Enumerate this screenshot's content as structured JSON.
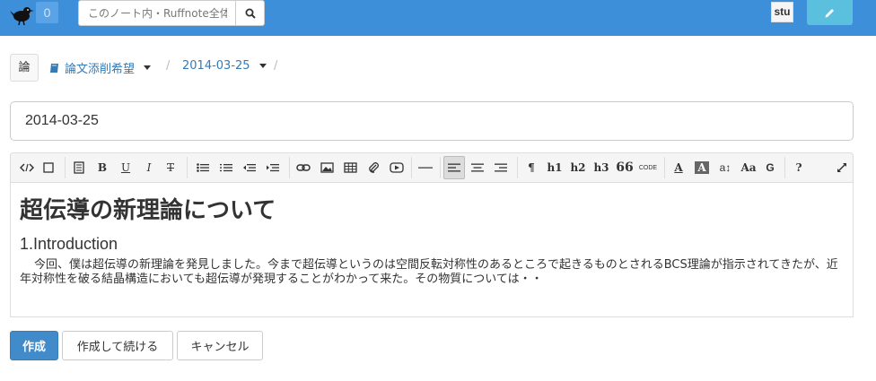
{
  "navbar": {
    "notification_count": "0",
    "search_placeholder": "このノート内・Ruffnote全体",
    "user_label": "stu"
  },
  "breadcrumb": {
    "note_icon_label": "論",
    "notebook_label": "論文添削希望",
    "page_label": "2014-03-25",
    "separator": "/"
  },
  "title_field": {
    "value": "2014-03-25"
  },
  "toolbar": {
    "bold_label": "B",
    "underline_label": "U",
    "italic_label": "I",
    "strike_label": "T",
    "paragraph_label": "¶",
    "h1_label": "h1",
    "h2_label": "h2",
    "h3_label": "h3",
    "quote_label": "66",
    "code_label": "CODE",
    "font_color_label": "A",
    "bg_color_label": "A",
    "line_height_label": "a↕",
    "font_size_label": "Aa",
    "google_font_label": "G",
    "help_label": "?"
  },
  "editor": {
    "heading": "超伝導の新理論について",
    "subheading": "1.Introduction",
    "paragraph": "今回、僕は超伝導の新理論を発見しました。今まで超伝導というのは空間反転対称性のあるところで起きるものとされるBCS理論が指示されてきたが、近年対称性を破る結晶構造においても超伝導が発現することがわかって来た。その物質については・・"
  },
  "actions": {
    "create_label": "作成",
    "create_continue_label": "作成して続ける",
    "cancel_label": "キャンセル"
  },
  "colors": {
    "navbar": "#3c8fd8",
    "primary": "#428bca",
    "info": "#5bc0de",
    "link": "#337ab7"
  }
}
